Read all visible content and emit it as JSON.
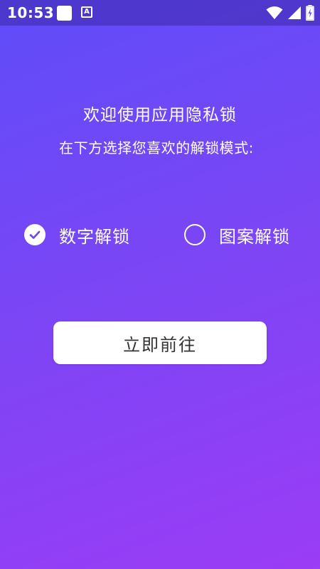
{
  "status_bar": {
    "time": "10:53",
    "notification_icon_letter": "A",
    "icons": [
      "notification-square-icon",
      "accessibility-a-icon",
      "wifi-icon",
      "signal-icon",
      "battery-charging-icon"
    ]
  },
  "header": {
    "title": "欢迎使用应用隐私锁",
    "subtitle": "在下方选择您喜欢的解锁模式:"
  },
  "unlock_options": [
    {
      "label": "数字解锁",
      "selected": true
    },
    {
      "label": "图案解锁",
      "selected": false
    }
  ],
  "action": {
    "button_label": "立即前往"
  },
  "colors": {
    "gradient_start": "#5f4cf9",
    "gradient_end": "#9b3cf6",
    "button_bg": "#ffffff",
    "button_text": "#333333",
    "text": "#ffffff"
  }
}
